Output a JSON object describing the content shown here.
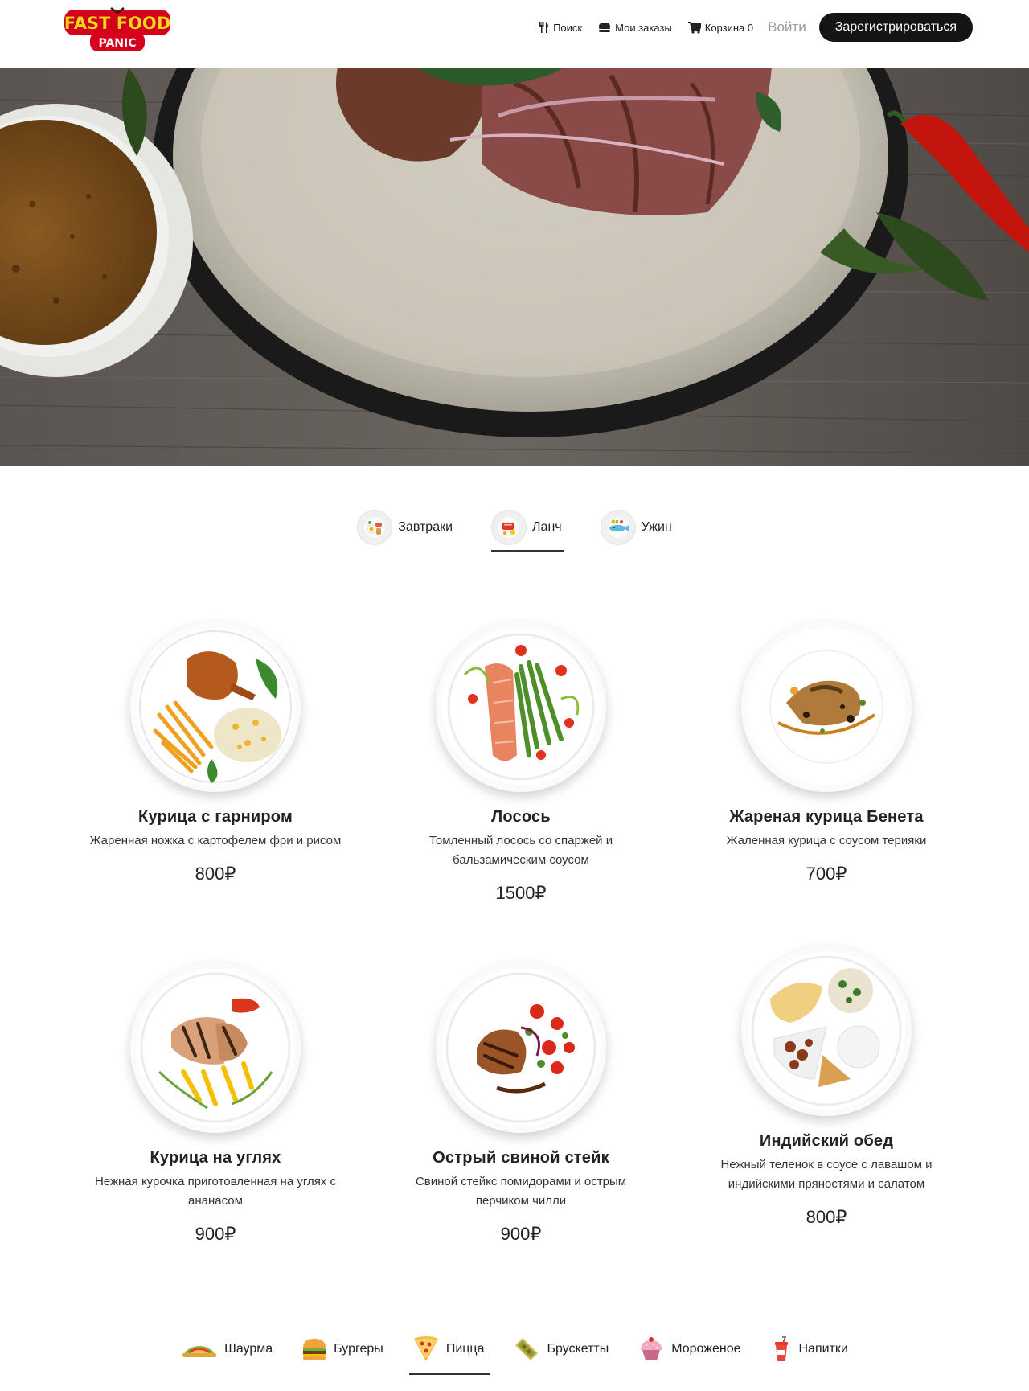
{
  "brand": {
    "logo_line1": "FAST FOOD",
    "logo_line2": "PANIC"
  },
  "nav": {
    "search": "Поиск",
    "orders": "Мои заказы",
    "cart": "Корзина 0",
    "login": "Войти",
    "register": "Зарегистрироваться"
  },
  "meal_tabs": [
    {
      "label": "Завтраки",
      "icon": "breakfast-icon",
      "active": false
    },
    {
      "label": "Ланч",
      "icon": "lunch-icon",
      "active": true
    },
    {
      "label": "Ужин",
      "icon": "dinner-icon",
      "active": false
    }
  ],
  "dishes": [
    {
      "name": "Курица с гарниром",
      "desc": "Жаренная ножка с картофелем фри и рисом",
      "price": "800₽"
    },
    {
      "name": "Лосось",
      "desc": "Томленный лосось со спаржей и бальзамическим соусом",
      "price": "1500₽"
    },
    {
      "name": "Жареная курица Бенета",
      "desc": "Жаленная курица с соусом терияки",
      "price": "700₽"
    },
    {
      "name": "Курица на углях",
      "desc": "Нежная курочка приготовленная на углях с ананасом",
      "price": "900₽"
    },
    {
      "name": "Острый свиной стейк",
      "desc": "Свиной стейкс помидорами и острым перчиком чилли",
      "price": "900₽"
    },
    {
      "name": "Индийский обед",
      "desc": "Нежный теленок в соусе с лавашом и индийскими пряностями и салатом",
      "price": "800₽"
    }
  ],
  "categories": [
    {
      "label": "Шаурма",
      "icon": "shawarma-icon",
      "active": false
    },
    {
      "label": "Бургеры",
      "icon": "burger-icon",
      "active": false
    },
    {
      "label": "Пицца",
      "icon": "pizza-icon",
      "active": true
    },
    {
      "label": "Брускетты",
      "icon": "bruschetta-icon",
      "active": false
    },
    {
      "label": "Мороженое",
      "icon": "ice-cream-icon",
      "active": false
    },
    {
      "label": "Напитки",
      "icon": "drink-icon",
      "active": false
    }
  ],
  "colors": {
    "accent_dark": "#141414",
    "logo_red": "#d6001c",
    "logo_yellow": "#ffd21f",
    "muted": "#9a9a9a"
  }
}
